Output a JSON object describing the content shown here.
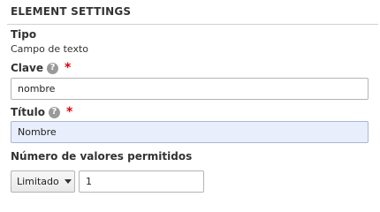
{
  "section": {
    "title": "ELEMENT SETTINGS"
  },
  "type": {
    "label": "Tipo",
    "value": "Campo de texto"
  },
  "key": {
    "label": "Clave",
    "required_mark": "*",
    "value": "nombre"
  },
  "title": {
    "label": "Título",
    "required_mark": "*",
    "value": "Nombre"
  },
  "allowed_values": {
    "label": "Número de valores permitidos",
    "mode_selected": "Limitado",
    "count_value": "1"
  },
  "colors": {
    "required": "#d8000c",
    "focused_input_bg": "#e8eefb"
  },
  "icons": {
    "help": "question-mark-circle-icon",
    "select": "chevron-down-icon"
  }
}
